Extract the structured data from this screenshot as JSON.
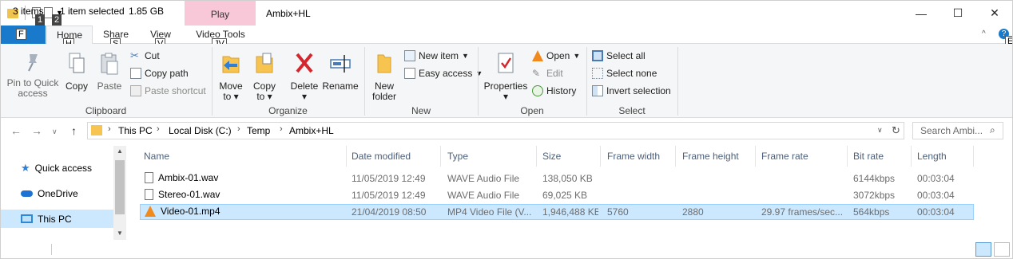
{
  "title_bar": {
    "window_title": "Ambix+HL",
    "context_tab": "Play",
    "controls": {
      "minimize": "—",
      "maximize": "☐",
      "close": "✕"
    },
    "keytips": {
      "qat1": "1",
      "qat2": "2"
    }
  },
  "tabs": {
    "file": "F",
    "items": [
      {
        "label": "Home",
        "keytip": "H",
        "active": true
      },
      {
        "label": "Share",
        "keytip": "S"
      },
      {
        "label": "View",
        "keytip": "V"
      },
      {
        "label": "Video Tools",
        "keytip": "JV"
      }
    ],
    "help_keytip": "E"
  },
  "ribbon": {
    "clipboard": {
      "label": "Clipboard",
      "pin": "Pin to Quick access",
      "pin_l1": "Pin to Quick",
      "pin_l2": "access",
      "copy": "Copy",
      "paste": "Paste",
      "cut": "Cut",
      "copy_path": "Copy path",
      "paste_shortcut": "Paste shortcut"
    },
    "organize": {
      "label": "Organize",
      "move_to": "Move",
      "move_to2": "to",
      "copy_to": "Copy",
      "copy_to2": "to",
      "delete": "Delete",
      "rename": "Rename"
    },
    "new": {
      "label": "New",
      "new_folder": "New",
      "new_folder2": "folder",
      "new_item": "New item",
      "easy_access": "Easy access"
    },
    "open": {
      "label": "Open",
      "properties": "Properties",
      "open": "Open",
      "edit": "Edit",
      "history": "History"
    },
    "select": {
      "label": "Select",
      "select_all": "Select all",
      "select_none": "Select none",
      "invert": "Invert selection"
    }
  },
  "address": {
    "crumbs": [
      "This PC",
      "Local Disk (C:)",
      "Temp",
      "Ambix+HL"
    ],
    "search_placeholder": "Search Ambi..."
  },
  "nav_pane": {
    "items": [
      {
        "label": "Quick access",
        "icon": "star-icon"
      },
      {
        "label": "OneDrive",
        "icon": "cloud-icon"
      },
      {
        "label": "This PC",
        "icon": "monitor-icon",
        "selected": true
      }
    ]
  },
  "columns": [
    "Name",
    "Date modified",
    "Type",
    "Size",
    "Frame width",
    "Frame height",
    "Frame rate",
    "Bit rate",
    "Length"
  ],
  "files": [
    {
      "name": "Ambix-01.wav",
      "date": "11/05/2019 12:49",
      "type": "WAVE Audio File",
      "size": "138,050 KB",
      "fw": "",
      "fh": "",
      "fr": "",
      "br": "6144kbps",
      "len": "00:03:04",
      "icon": "audio-file-icon"
    },
    {
      "name": "Stereo-01.wav",
      "date": "11/05/2019 12:49",
      "type": "WAVE Audio File",
      "size": "69,025 KB",
      "fw": "",
      "fh": "",
      "fr": "",
      "br": "3072kbps",
      "len": "00:03:04",
      "icon": "audio-file-icon"
    },
    {
      "name": "Video-01.mp4",
      "date": "21/04/2019 08:50",
      "type": "MP4 Video File (V...",
      "size": "1,946,488 KB",
      "fw": "5760",
      "fh": "2880",
      "fr": "29.97 frames/sec...",
      "br": "564kbps",
      "len": "00:03:04",
      "icon": "vlc-cone-icon",
      "selected": true
    }
  ],
  "status": {
    "count": "3 items",
    "selected": "1 item selected",
    "size": "1.85 GB"
  },
  "colors": {
    "file_tab": "#1979ca",
    "context_tab": "#f8c8d8",
    "selection": "#cce8ff",
    "ribbon_bg": "#f5f6f7"
  }
}
